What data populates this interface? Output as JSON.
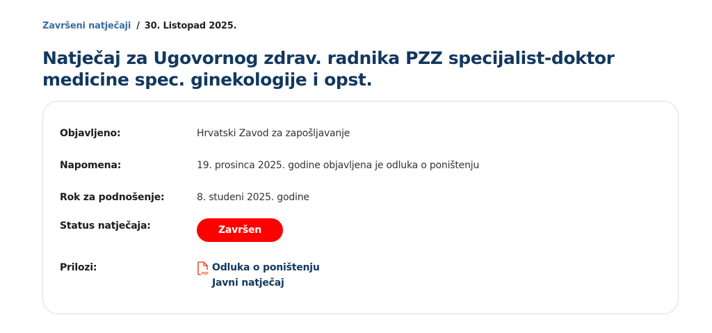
{
  "breadcrumb": {
    "parent": "Završeni natječaji",
    "separator": "/",
    "current": "30. Listopad 2025."
  },
  "title": "Natječaj za Ugovornog zdrav. radnika PZZ specijalist-doktor medicine spec. ginekologije i opst.",
  "details": {
    "published": {
      "label": "Objavljeno:",
      "value": "Hrvatski Zavod za zapošljavanje"
    },
    "note": {
      "label": "Napomena:",
      "value": "19. prosinca 2025. godine objavljena je odluka o poništenju"
    },
    "deadline": {
      "label": "Rok za podnošenje:",
      "value": "8. studeni 2025. godine"
    },
    "status": {
      "label": "Status natječaja:",
      "value": "Završen"
    },
    "attachments": {
      "label": "Prilozi:",
      "items": [
        {
          "label": "Odluka o poništenju",
          "icon": "pdf-file-icon"
        },
        {
          "label": "Javni natječaj"
        }
      ]
    }
  },
  "colors": {
    "title": "#13385f",
    "breadcrumb_link": "#3a6ea5",
    "status_badge": "#ff0000",
    "pdf_icon": "#e8542e",
    "card_border": "#dcdcdc"
  }
}
